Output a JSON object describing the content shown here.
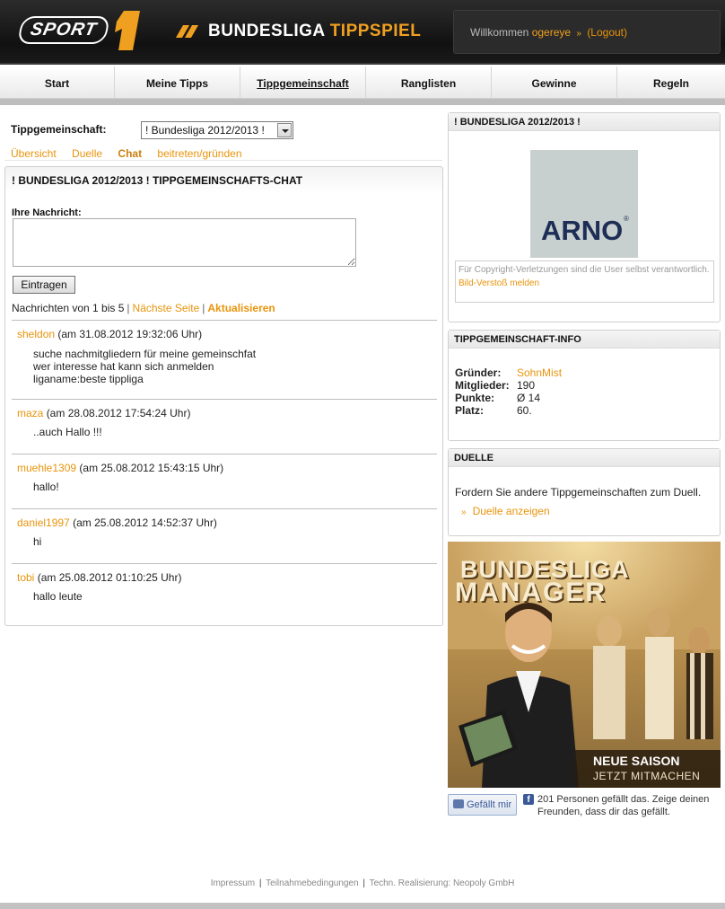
{
  "header": {
    "sport_logo": "SPORT",
    "sport_number": "1",
    "brand_part1": "BUNDESLIGA",
    "brand_part2": "TIPPSPIEL",
    "welcome_text": "Willkommen",
    "username": "ogereye",
    "logout_label": "(Logout)"
  },
  "nav": {
    "items": [
      {
        "label": "Start"
      },
      {
        "label": "Meine Tipps"
      },
      {
        "label": "Tippgemeinschaft",
        "active": true
      },
      {
        "label": "Ranglisten"
      },
      {
        "label": "Gewinne"
      },
      {
        "label": "Regeln"
      }
    ]
  },
  "community": {
    "label": "Tippgemeinschaft:",
    "selected": "! Bundesliga 2012/2013 !",
    "subnav": [
      "Übersicht",
      "Duelle",
      "Chat",
      "beitreten/gründen"
    ],
    "current_subnav": "Chat"
  },
  "chat": {
    "title": "! BUNDESLIGA 2012/2013 ! TIPPGEMEINSCHAFTS-CHAT",
    "message_label": "Ihre Nachricht:",
    "message_value": "",
    "submit_label": "Eintragen",
    "pager_text": "Nachrichten von 1 bis 5",
    "pager_sep": "|",
    "next_label": "Nächste Seite",
    "refresh_label": "Aktualisieren",
    "messages": [
      {
        "user": "sheldon",
        "date": "(am 31.08.2012 19:32:06 Uhr)",
        "lines": [
          "suche nachmitgliedern für meine gemeinschfat",
          "wer interesse hat kann sich anmelden",
          "liganame:beste tippliga"
        ]
      },
      {
        "user": "maza",
        "date": "(am 28.08.2012 17:54:24 Uhr)",
        "lines": [
          "..auch Hallo !!!"
        ]
      },
      {
        "user": "muehle1309",
        "date": "(am 25.08.2012 15:43:15 Uhr)",
        "lines": [
          "hallo!"
        ]
      },
      {
        "user": "daniel1997",
        "date": "(am 25.08.2012 14:52:37 Uhr)",
        "lines": [
          "hi"
        ]
      },
      {
        "user": "tobi",
        "date": "(am 25.08.2012 01:10:25 Uhr)",
        "lines": [
          "hallo leute"
        ]
      }
    ]
  },
  "sidebar": {
    "group_box": {
      "title": "! BUNDESLIGA 2012/2013 !",
      "image_text": "ARNO",
      "image_mark": "®",
      "copyright_note": "Für Copyright-Verletzungen sind die User selbst verantwortlich.",
      "report_link": "Bild-Verstoß melden"
    },
    "info_box": {
      "title": "TIPPGEMEINSCHAFT-INFO",
      "rows": [
        {
          "key": "Gründer:",
          "value": "SohnMist",
          "link": true
        },
        {
          "key": "Mitglieder:",
          "value": "190"
        },
        {
          "key": "Punkte:",
          "value": "Ø 14"
        },
        {
          "key": "Platz:",
          "value": "60."
        }
      ]
    },
    "duelle_box": {
      "title": "DUELLE",
      "text": "Fordern Sie andere Tippgemeinschaften zum Duell.",
      "link": "Duelle anzeigen"
    },
    "banner": {
      "title_line1": "BUNDESLIGA",
      "title_line2": "MANAGER",
      "cta_line1": "NEUE SAISON",
      "cta_line2": "JETZT MITMACHEN"
    },
    "facebook": {
      "like_label": "Gefällt mir",
      "icon_letter": "f",
      "text": "201 Personen gefällt das. Zeige deinen Freunden, dass dir das gefällt."
    }
  },
  "footer": {
    "links": [
      "Impressum",
      "Teilnahmebedingungen",
      "Techn. Realisierung: Neopoly GmbH"
    ],
    "sep": "|"
  },
  "colors": {
    "accent": "#e8940c",
    "header_bg": "#111111",
    "brand_orange": "#f0a020"
  },
  "icons": {
    "select_arrow": "chevron-down-icon",
    "link_arrow": "double-chevron-right-icon",
    "facebook": "facebook-icon",
    "like": "thumbs-up-icon"
  }
}
